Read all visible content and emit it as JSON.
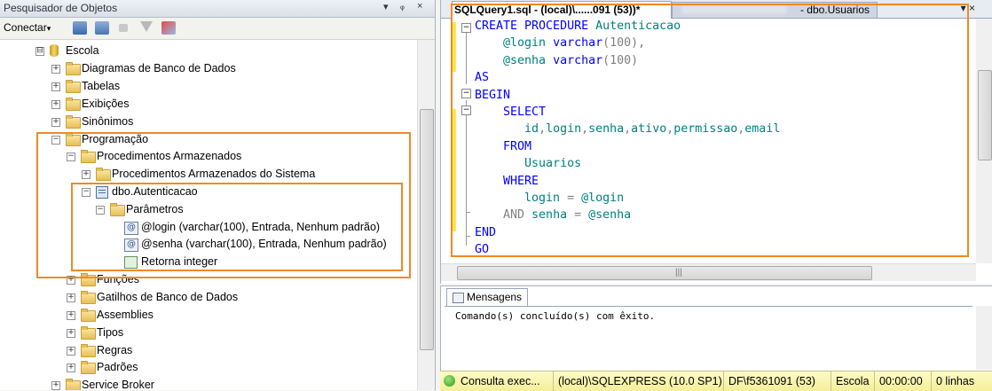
{
  "object_explorer": {
    "title": "Pesquisador de Objetos",
    "title_controls": [
      "▾",
      "ᵩ",
      "×"
    ],
    "connect_label": "Conectar",
    "connect_arrow": "▾"
  },
  "tree": [
    {
      "label": "Escola",
      "expander": "⊟",
      "icon": "database-icon"
    },
    {
      "label": "Diagramas de Banco de Dados",
      "expander": "+",
      "icon": "folder-icon"
    },
    {
      "label": "Tabelas",
      "expander": "+",
      "icon": "folder-icon"
    },
    {
      "label": "Exibições",
      "expander": "+",
      "icon": "folder-icon"
    },
    {
      "label": "Sinônimos",
      "expander": "+",
      "icon": "folder-icon"
    },
    {
      "label": "Programação",
      "expander": "−",
      "icon": "folder-icon"
    },
    {
      "label": "Procedimentos Armazenados",
      "expander": "−",
      "icon": "folder-icon"
    },
    {
      "label": "Procedimentos Armazenados do Sistema",
      "expander": "+",
      "icon": "folder-icon"
    },
    {
      "label": "dbo.Autenticacao",
      "expander": "−",
      "icon": "procedure-icon"
    },
    {
      "label": "Parâmetros",
      "expander": "−",
      "icon": "folder-icon"
    },
    {
      "label": "@login (varchar(100), Entrada, Nenhum padrão)",
      "expander": "",
      "icon": "parameter-icon",
      "glyph": "@"
    },
    {
      "label": "@senha (varchar(100), Entrada, Nenhum padrão)",
      "expander": "",
      "icon": "parameter-icon",
      "glyph": "@"
    },
    {
      "label": "Retorna integer",
      "expander": "",
      "icon": "return-value-icon"
    },
    {
      "label": "Funções",
      "expander": "+",
      "icon": "folder-icon"
    },
    {
      "label": "Gatilhos de Banco de Dados",
      "expander": "+",
      "icon": "folder-icon"
    },
    {
      "label": "Assemblies",
      "expander": "+",
      "icon": "folder-icon"
    },
    {
      "label": "Tipos",
      "expander": "+",
      "icon": "folder-icon"
    },
    {
      "label": "Regras",
      "expander": "+",
      "icon": "folder-icon"
    },
    {
      "label": "Padrões",
      "expander": "+",
      "icon": "folder-icon"
    },
    {
      "label": "Service Broker",
      "expander": "+",
      "icon": "folder-icon"
    }
  ],
  "editor": {
    "active_tab": "SQLQuery1.sql - (local)\\......091 (53))*",
    "other_tab": "- dbo.Usuarios",
    "close_glyph": "▾ ×",
    "lines": [
      [
        {
          "t": "CREATE PROCEDURE ",
          "c": "kw"
        },
        {
          "t": "Autenticacao",
          "c": "tl"
        }
      ],
      [
        {
          "t": "    @login ",
          "c": "tl"
        },
        {
          "t": "varchar",
          "c": "kw"
        },
        {
          "t": "(100),",
          "c": "gr"
        }
      ],
      [
        {
          "t": "    @senha ",
          "c": "tl"
        },
        {
          "t": "varchar",
          "c": "kw"
        },
        {
          "t": "(100)",
          "c": "gr"
        }
      ],
      [
        {
          "t": "AS",
          "c": "kw"
        }
      ],
      [
        {
          "t": "BEGIN",
          "c": "kw"
        }
      ],
      [
        {
          "t": "    SELECT",
          "c": "kw"
        }
      ],
      [
        {
          "t": "       id",
          "c": "tl"
        },
        {
          "t": ",",
          "c": "gr"
        },
        {
          "t": "login",
          "c": "tl"
        },
        {
          "t": ",",
          "c": "gr"
        },
        {
          "t": "senha",
          "c": "tl"
        },
        {
          "t": ",",
          "c": "gr"
        },
        {
          "t": "ativo",
          "c": "tl"
        },
        {
          "t": ",",
          "c": "gr"
        },
        {
          "t": "permissao",
          "c": "tl"
        },
        {
          "t": ",",
          "c": "gr"
        },
        {
          "t": "email",
          "c": "tl"
        }
      ],
      [
        {
          "t": "    FROM",
          "c": "kw"
        }
      ],
      [
        {
          "t": "       Usuarios",
          "c": "tl"
        }
      ],
      [
        {
          "t": "    WHERE",
          "c": "kw"
        }
      ],
      [
        {
          "t": "       login ",
          "c": "tl"
        },
        {
          "t": "= ",
          "c": "gr"
        },
        {
          "t": "@login",
          "c": "tl"
        }
      ],
      [
        {
          "t": "    AND ",
          "c": "gr"
        },
        {
          "t": "senha ",
          "c": "tl"
        },
        {
          "t": "= ",
          "c": "gr"
        },
        {
          "t": "@senha",
          "c": "tl"
        }
      ],
      [
        {
          "t": "END",
          "c": "kw"
        }
      ],
      [
        {
          "t": "GO",
          "c": "kw"
        }
      ]
    ]
  },
  "messages": {
    "tab_label": "Mensagens",
    "text": "Comando(s) concluído(s) com êxito."
  },
  "status_bar": {
    "state": "Consulta exec...",
    "server": "(local)\\SQLEXPRESS (10.0 SP1)",
    "user": "DF\\f5361091 (53)",
    "database": "Escola",
    "elapsed": "00:00:00",
    "rows": "0 linhas"
  },
  "colors": {
    "highlight": "#f08a24",
    "keyword": "#0000ff",
    "operator": "#808080",
    "identifier": "#008080",
    "status_bg": "#f5ee98"
  }
}
